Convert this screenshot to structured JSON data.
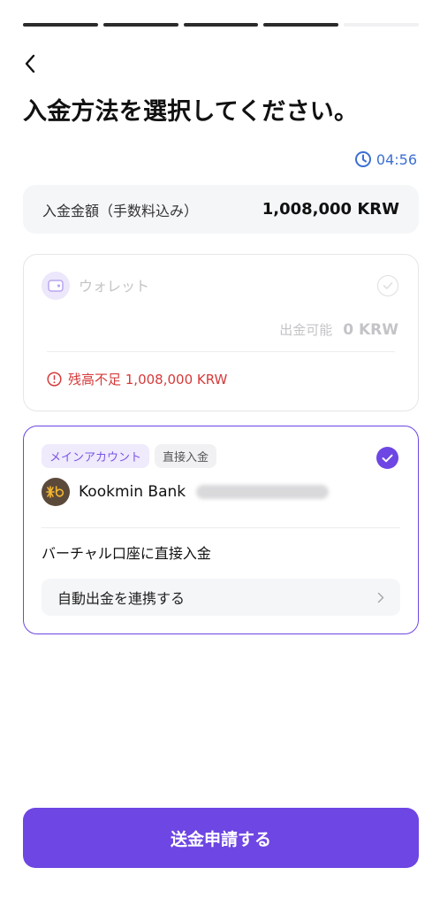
{
  "title": "入金方法を選択してください。",
  "timer": "04:56",
  "amount": {
    "label": "入金金額（手数料込み）",
    "value": "1,008,000 KRW"
  },
  "wallet": {
    "name": "ウォレット",
    "available_label": "出金可能",
    "available_value": "0 KRW",
    "warning": "残高不足 1,008,000 KRW"
  },
  "bank": {
    "badge_main": "メインアカウント",
    "badge_direct": "直接入金",
    "name": "Kookmin Bank",
    "virtual_text": "バーチャル口座に直接入金",
    "auto_withdraw": "自動出金を連携する"
  },
  "submit_label": "送金申請する",
  "colors": {
    "accent": "#6d46e3",
    "timer": "#3b6fd1",
    "warning": "#d63a3a"
  }
}
